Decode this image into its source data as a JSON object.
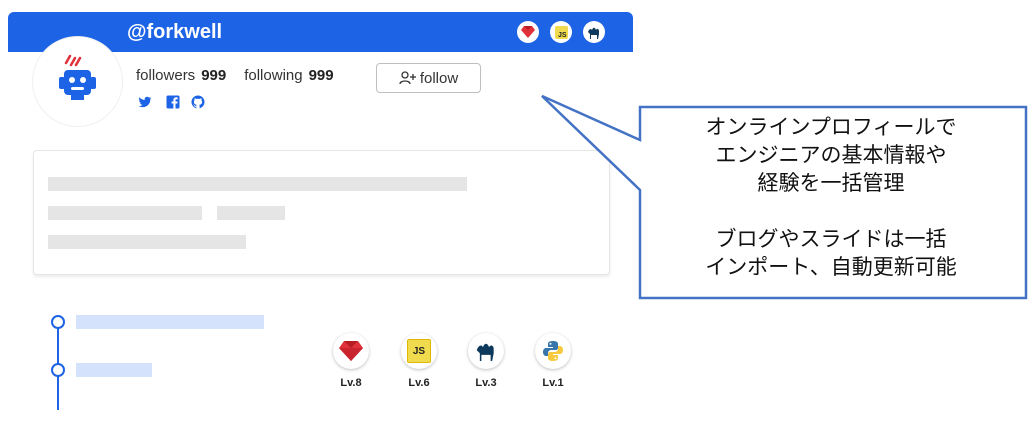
{
  "profile": {
    "username": "@forkwell",
    "followers_label": "followers",
    "followers_count": "999",
    "following_label": "following",
    "following_count": "999",
    "follow_button": "follow"
  },
  "header_badges": [
    "ruby-icon",
    "javascript-icon",
    "perl-camel-icon"
  ],
  "social_icons": [
    "twitter-icon",
    "facebook-icon",
    "github-icon"
  ],
  "skills": [
    {
      "icon": "ruby-icon",
      "level": "Lv.8"
    },
    {
      "icon": "javascript-icon",
      "level": "Lv.6"
    },
    {
      "icon": "perl-camel-icon",
      "level": "Lv.3"
    },
    {
      "icon": "python-icon",
      "level": "Lv.1"
    }
  ],
  "badge_text": {
    "js": "JS"
  },
  "callout": {
    "lines": [
      "オンラインプロフィールで",
      "エンジニアの基本情報や",
      "経験を一括管理",
      "",
      "ブログやスライドは一括",
      "インポート、自動更新可能"
    ]
  },
  "colors": {
    "brand_blue": "#1d63e6",
    "skeleton_gray": "#e5e5e5",
    "timeline_skeleton": "#d5e2fb",
    "ruby_red": "#e0313b",
    "js_yellow": "#f0db4f"
  }
}
